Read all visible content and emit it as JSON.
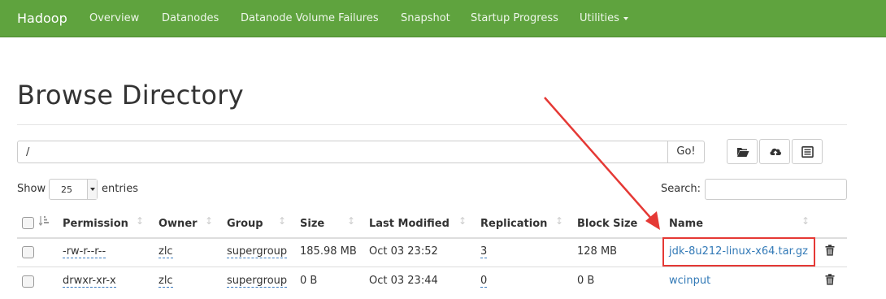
{
  "navbar": {
    "brand": "Hadoop",
    "items": [
      {
        "label": "Overview"
      },
      {
        "label": "Datanodes"
      },
      {
        "label": "Datanode Volume Failures"
      },
      {
        "label": "Snapshot"
      },
      {
        "label": "Startup Progress"
      },
      {
        "label": "Utilities"
      }
    ]
  },
  "page": {
    "title": "Browse Directory",
    "path_value": "/",
    "go_label": "Go!"
  },
  "toolbar": {
    "icons": [
      "folder-open-icon",
      "cloud-upload-icon",
      "list-alt-icon"
    ]
  },
  "table_controls": {
    "show_label": "Show",
    "entries_value": "25",
    "entries_label": "entries",
    "search_label": "Search:",
    "search_value": ""
  },
  "table": {
    "columns": [
      "Permission",
      "Owner",
      "Group",
      "Size",
      "Last Modified",
      "Replication",
      "Block Size",
      "Name"
    ],
    "rows": [
      {
        "permission": "-rw-r--r--",
        "owner": "zlc",
        "group": "supergroup",
        "size": "185.98 MB",
        "last_modified": "Oct 03 23:52",
        "replication": "3",
        "block_size": "128 MB",
        "name": "jdk-8u212-linux-x64.tar.gz"
      },
      {
        "permission": "drwxr-xr-x",
        "owner": "zlc",
        "group": "supergroup",
        "size": "0 B",
        "last_modified": "Oct 03 23:44",
        "replication": "0",
        "block_size": "0 B",
        "name": "wcinput"
      }
    ]
  },
  "annotation": {
    "color": "#e53935"
  },
  "colors": {
    "navbar": "#5fa33e",
    "link": "#337ab7"
  }
}
